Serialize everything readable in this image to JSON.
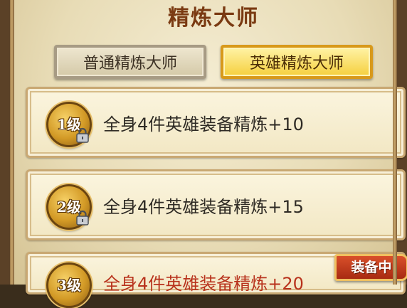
{
  "title": "精炼大师",
  "tabs": [
    {
      "label": "普通精炼大师",
      "active": false
    },
    {
      "label": "英雄精炼大师",
      "active": true
    }
  ],
  "levels": [
    {
      "badge": "1级",
      "description": "全身4件英雄装备精炼+10",
      "locked": true
    },
    {
      "badge": "2级",
      "description": "全身4件英雄装备精炼+15",
      "locked": true
    },
    {
      "badge": "3级",
      "description": "全身4件英雄装备精炼+20",
      "locked": false,
      "status": "装备中"
    }
  ],
  "colors": {
    "title": "#7a3a12",
    "active_tab": "#f5cf3d",
    "equipped_text": "#b8321c",
    "equip_tag": "#c0391a"
  },
  "icons": [
    "lock-icon"
  ]
}
